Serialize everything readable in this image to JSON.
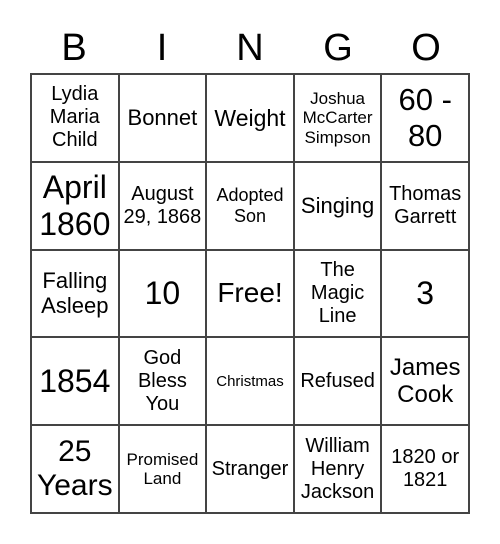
{
  "header": [
    "B",
    "I",
    "N",
    "G",
    "O"
  ],
  "cells": [
    "Lydia Maria Child",
    "Bonnet",
    "Weight",
    "Joshua McCarter Simpson",
    "60 - 80",
    "April 1860",
    "August 29, 1868",
    "Adopted Son",
    "Singing",
    "Thomas Garrett",
    "Falling Asleep",
    "10",
    "Free!",
    "The Magic Line",
    "3",
    "1854",
    "God Bless You",
    "Christmas",
    "Refused",
    "James Cook",
    "25 Years",
    "Promised Land",
    "Stranger",
    "William Henry Jackson",
    "1820 or 1821"
  ]
}
